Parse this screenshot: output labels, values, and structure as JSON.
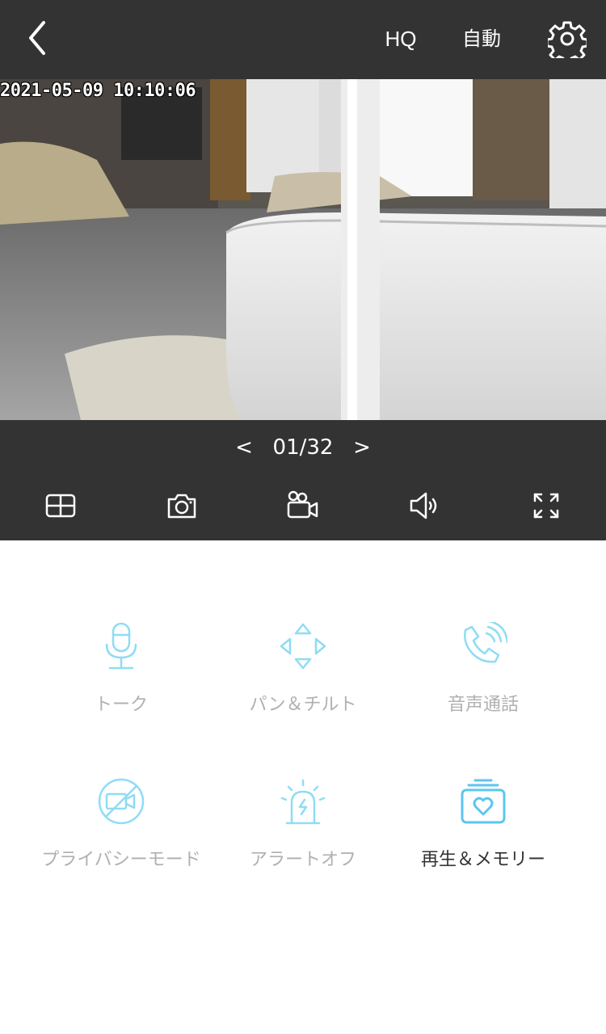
{
  "header": {
    "quality_label": "HQ",
    "mode_label": "自動"
  },
  "video": {
    "timestamp": "2021-05-09  10:10:06"
  },
  "player": {
    "page_indicator": "01/32",
    "prev_symbol": "<",
    "next_symbol": ">"
  },
  "features": [
    {
      "label": "トーク",
      "icon": "microphone-icon"
    },
    {
      "label": "パン＆チルト",
      "icon": "pan-tilt-arrows-icon"
    },
    {
      "label": "音声通話",
      "icon": "phone-call-icon"
    },
    {
      "label": "プライバシーモード",
      "icon": "privacy-camera-off-icon"
    },
    {
      "label": "アラートオフ",
      "icon": "alarm-siren-icon"
    },
    {
      "label": "再生＆メモリー",
      "icon": "playback-memory-icon"
    }
  ],
  "colors": {
    "bar": "#333333",
    "accent": "#6fd0f0",
    "label_muted": "#b0b0b0",
    "label_active": "#333333"
  }
}
